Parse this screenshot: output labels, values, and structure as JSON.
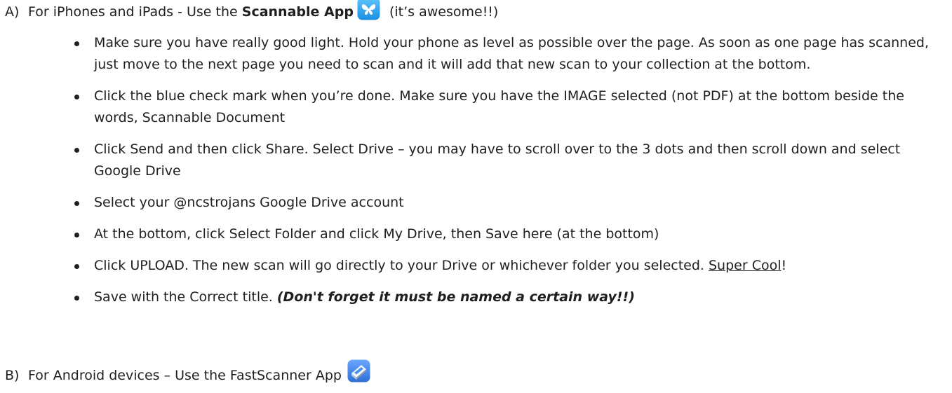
{
  "section_a": {
    "marker": "A)",
    "intro": "For iPhones and iPads - Use the ",
    "app_name": "Scannable App",
    "icon": "butterfly-app-icon",
    "suffix": " (it’s awesome!!)"
  },
  "bullets": [
    {
      "text": "Make sure you have really good light. Hold your phone as level as possible over the page. As soon as one page has scanned, just move to the next page you need to scan and it will add that new scan to your collection at the bottom."
    },
    {
      "text": "Click the blue check mark when you’re done. Make sure you have the IMAGE selected (not PDF) at the bottom beside the words, Scannable Document"
    },
    {
      "text": "Click Send and then click Share. Select Drive – you may have to scroll over to the 3 dots and then scroll down and select Google Drive"
    },
    {
      "text": "Select your @ncstrojans Google Drive account"
    },
    {
      "text": "At the bottom, click Select Folder and click My Drive, then Save here (at the bottom)"
    },
    {
      "text": "Click UPLOAD. The new scan will go directly to your Drive or whichever folder you selected. ",
      "underlined": "Super Cool",
      "end": "!"
    },
    {
      "text": "Save with the Correct title. ",
      "emphasis": "(Don't forget it must be named a certain way!!)"
    }
  ],
  "section_b": {
    "marker": "B)",
    "text": "For Android devices – Use the FastScanner App",
    "icon": "scanner-app-icon"
  },
  "colors": {
    "text": "#1f1f1f",
    "scannable_blue": "#1ea1f2",
    "fastscanner_blue": "#2f6fd6"
  }
}
